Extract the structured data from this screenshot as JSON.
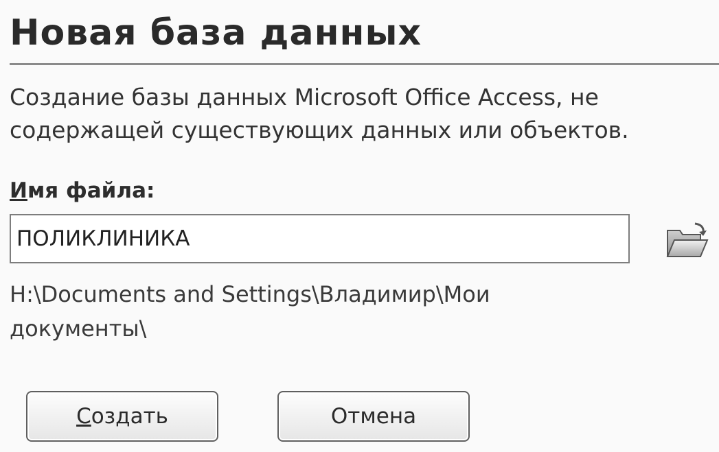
{
  "dialog": {
    "title": "Новая база данных",
    "description_line1": "Создание базы данных Microsoft Office Access, не",
    "description_line2": "содержащей существующих данных или объектов.",
    "filename_label_accel": "И",
    "filename_label_rest": "мя файла:",
    "filename_value": "ПОЛИКЛИНИКА",
    "path_line1": "H:\\Documents and Settings\\Владимир\\Мои",
    "path_line2": "документы\\",
    "create_button_accel": "С",
    "create_button_rest": "оздать",
    "cancel_button_label": "Отмена",
    "folder_icon": "open-folder-icon"
  }
}
